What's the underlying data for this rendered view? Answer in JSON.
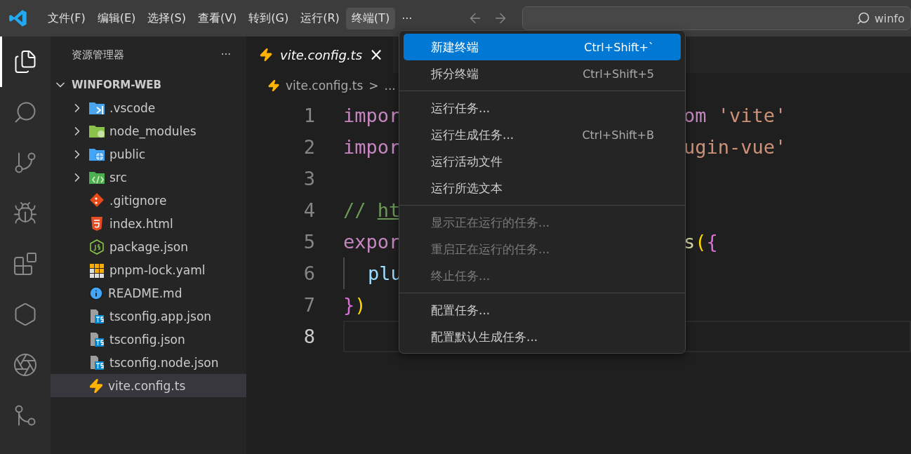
{
  "menubar": [
    {
      "label": "文件(F)",
      "selected": false
    },
    {
      "label": "编辑(E)",
      "selected": false
    },
    {
      "label": "选择(S)",
      "selected": false
    },
    {
      "label": "查看(V)",
      "selected": false
    },
    {
      "label": "转到(G)",
      "selected": false
    },
    {
      "label": "运行(R)",
      "selected": false
    },
    {
      "label": "终端(T)",
      "selected": true
    },
    {
      "label": "···",
      "selected": false
    }
  ],
  "search": {
    "value": "winfo"
  },
  "activity_bar": [
    {
      "kind": "files",
      "selected": true
    },
    {
      "kind": "search",
      "selected": false
    },
    {
      "kind": "git",
      "selected": false
    },
    {
      "kind": "debug",
      "selected": false
    },
    {
      "kind": "extensions",
      "selected": false
    },
    {
      "kind": "star",
      "selected": false
    },
    {
      "kind": "ai",
      "selected": false
    },
    {
      "kind": "merge",
      "selected": false
    }
  ],
  "sidebar": {
    "title": "资源管理器",
    "more": "···",
    "root": "WINFORM-WEB",
    "root_expanded": true,
    "items": [
      {
        "name": ".vscode",
        "kind": "vscode",
        "selected": false
      },
      {
        "name": "node_modules",
        "kind": "node",
        "selected": false
      },
      {
        "name": "public",
        "kind": "public",
        "selected": false
      },
      {
        "name": "src",
        "kind": "src",
        "selected": false
      },
      {
        "name": ".gitignore",
        "kind": "git",
        "selected": false
      },
      {
        "name": "index.html",
        "kind": "html",
        "selected": false
      },
      {
        "name": "package.json",
        "kind": "js",
        "selected": false
      },
      {
        "name": "pnpm-lock.yaml",
        "kind": "pnpm",
        "selected": false
      },
      {
        "name": "README.md",
        "kind": "info",
        "selected": false
      },
      {
        "name": "tsconfig.app.json",
        "kind": "ts",
        "selected": false
      },
      {
        "name": "tsconfig.json",
        "kind": "ts",
        "selected": false
      },
      {
        "name": "tsconfig.node.json",
        "kind": "ts",
        "selected": false
      },
      {
        "name": "vite.config.ts",
        "kind": "vite",
        "selected": true
      }
    ]
  },
  "tabs": [
    {
      "label": "vite.config.ts",
      "close": "×",
      "selected": true
    }
  ],
  "breadcrumb": {
    "file": "vite.config.ts",
    "separator": ">",
    "rest": "..."
  },
  "code": [
    {
      "number": "1",
      "current": false,
      "left": [
        {
          "kind": "keyword",
          "text": "impor"
        }
      ],
      "right": [
        {
          "kind": "keyword",
          "text": "om"
        },
        {
          "kind": "string",
          "text": "'vite'",
          "gap": true
        }
      ]
    },
    {
      "number": "2",
      "current": false,
      "left": [
        {
          "kind": "keyword",
          "text": "impor"
        }
      ],
      "right": [
        {
          "kind": "string",
          "text": "ugin-vue'"
        }
      ]
    },
    {
      "number": "3",
      "current": false
    },
    {
      "number": "4",
      "current": false,
      "left": [
        {
          "kind": "comment",
          "text": "//"
        },
        {
          "kind": "link",
          "text": "ht",
          "gap": true
        }
      ]
    },
    {
      "number": "5",
      "current": false,
      "left": [
        {
          "kind": "keyword",
          "text": "expor"
        }
      ],
      "right": [
        {
          "kind": "function",
          "text": "s"
        },
        {
          "kind": "bracket1",
          "text": "("
        },
        {
          "kind": "bracket2",
          "text": "{"
        }
      ]
    },
    {
      "number": "6",
      "current": false,
      "indent": true,
      "left": [
        {
          "kind": "property",
          "text": "plu"
        }
      ]
    },
    {
      "number": "7",
      "current": false,
      "left": [
        {
          "kind": "bracket2",
          "text": "}"
        },
        {
          "kind": "bracket1",
          "text": ")"
        }
      ]
    },
    {
      "number": "8",
      "current": true
    }
  ],
  "terminal_menu": [
    [
      {
        "label": "新建终端",
        "shortcut": "Ctrl+Shift+`",
        "selected": true,
        "disabled": false
      },
      {
        "label": "拆分终端",
        "shortcut": "Ctrl+Shift+5",
        "selected": false,
        "disabled": false
      }
    ],
    [
      {
        "label": "运行任务...",
        "selected": false,
        "disabled": false
      },
      {
        "label": "运行生成任务...",
        "shortcut": "Ctrl+Shift+B",
        "selected": false,
        "disabled": false
      },
      {
        "label": "运行活动文件",
        "selected": false,
        "disabled": false
      },
      {
        "label": "运行所选文本",
        "selected": false,
        "disabled": false
      }
    ],
    [
      {
        "label": "显示正在运行的任务...",
        "selected": false,
        "disabled": true
      },
      {
        "label": "重启正在运行的任务...",
        "selected": false,
        "disabled": true
      },
      {
        "label": "终止任务...",
        "selected": false,
        "disabled": true
      }
    ],
    [
      {
        "label": "配置任务...",
        "selected": false,
        "disabled": false
      },
      {
        "label": "配置默认生成任务...",
        "selected": false,
        "disabled": false
      }
    ]
  ]
}
